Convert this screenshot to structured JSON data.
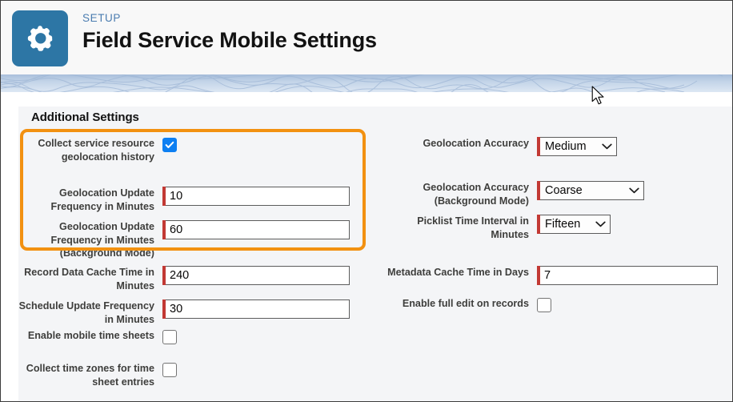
{
  "header": {
    "eyebrow": "SETUP",
    "title": "Field Service Mobile Settings",
    "icon": "gear-icon",
    "icon_tile_color": "#2d76a5"
  },
  "section": {
    "title": "Additional Settings"
  },
  "highlight": {
    "color": "#f29111",
    "note": "orange highlight rectangle around the first three left-column fields"
  },
  "colors": {
    "required_bar": "#c23934",
    "checkbox_checked": "#0d7ff2",
    "setup_text": "#4a7cb0",
    "panel_bg": "#f4f5f7",
    "band_blue": "#c3d4e8"
  },
  "left_column": [
    {
      "label": "Collect service resource geolocation history",
      "control": "checkbox",
      "checked": true,
      "required": false,
      "name": "collect-service-resource-geolocation-history"
    },
    {
      "label": "Geolocation Update Frequency in Minutes",
      "control": "text",
      "value": "10",
      "required": true,
      "name": "geolocation-update-frequency-in-minutes"
    },
    {
      "label": "Geolocation Update Frequency in Minutes (Background Mode)",
      "control": "text",
      "value": "60",
      "required": true,
      "name": "geolocation-update-frequency-in-minutes-background-mode"
    },
    {
      "label": "Record Data Cache Time in Minutes",
      "control": "text",
      "value": "240",
      "required": true,
      "name": "record-data-cache-time-in-minutes"
    },
    {
      "label": "Schedule Update Frequency in Minutes",
      "control": "text",
      "value": "30",
      "required": true,
      "name": "schedule-update-frequency-in-minutes"
    },
    {
      "label": "Enable mobile time sheets",
      "control": "checkbox",
      "checked": false,
      "required": false,
      "name": "enable-mobile-time-sheets"
    },
    {
      "label": "Collect time zones for time sheet entries",
      "control": "checkbox",
      "checked": false,
      "required": false,
      "name": "collect-time-zones-for-time-sheet-entries"
    }
  ],
  "right_column": [
    {
      "label": "Geolocation Accuracy",
      "control": "select",
      "value": "Medium",
      "required": true,
      "name": "geolocation-accuracy"
    },
    {
      "label": "Geolocation Accuracy (Background Mode)",
      "control": "select",
      "value": "Coarse",
      "required": true,
      "name": "geolocation-accuracy-background-mode"
    },
    {
      "label": "Picklist Time Interval in Minutes",
      "control": "select",
      "value": "Fifteen",
      "required": true,
      "name": "picklist-time-interval-in-minutes"
    },
    {
      "label": "Metadata Cache Time in Days",
      "control": "text",
      "value": "7",
      "required": true,
      "name": "metadata-cache-time-in-days"
    },
    {
      "label": "Enable full edit on records",
      "control": "checkbox",
      "checked": false,
      "required": false,
      "name": "enable-full-edit-on-records"
    }
  ]
}
